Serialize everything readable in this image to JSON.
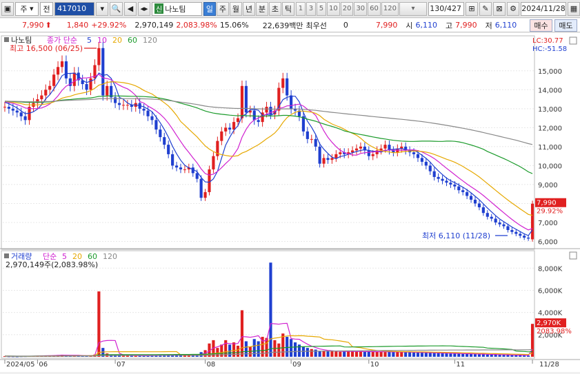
{
  "toolbar": {
    "mode": "주",
    "mode2": "전",
    "code": "417010",
    "shin": "신",
    "name": "나노팀",
    "periods": [
      "일",
      "주",
      "월",
      "년",
      "분",
      "초",
      "틱"
    ],
    "active_period": "일",
    "nums": [
      "1",
      "3",
      "5",
      "10",
      "20",
      "30",
      "60",
      "120"
    ],
    "count": "130/427",
    "date": "2024/11/28"
  },
  "quote": {
    "price": "7,990",
    "change": "1,840",
    "change_pct": "+29.92%",
    "volume": "2,970,149",
    "volume_pct": "2,083.98%",
    "turnover": "15.06%",
    "amount": "22,639백만",
    "best_label": "최우선",
    "best_value": "0",
    "best_price": "7,990",
    "open_label": "시",
    "open": "6,110",
    "high_label": "고",
    "high": "7,990",
    "low_label": "저",
    "low": "6,110",
    "buy": "매수",
    "sell": "매도"
  },
  "price_panel": {
    "stock": "나노팀",
    "legend_prefix": "종가 단순",
    "ma": [
      {
        "period": "5",
        "color": "#1f3fd0"
      },
      {
        "period": "10",
        "color": "#d020d0"
      },
      {
        "period": "20",
        "color": "#e6a800"
      },
      {
        "period": "60",
        "color": "#1a9a2a"
      },
      {
        "period": "120",
        "color": "#888888"
      }
    ],
    "lc": "LC:30.77",
    "hc": "HC:-51.58",
    "high_note": "최고 16,500 (06/25)",
    "low_note": "최저 6,110 (11/28)",
    "last_price": "7,990",
    "last_pct": "29.92%"
  },
  "volume_panel": {
    "title": "거래량",
    "legend_prefix": "단순",
    "ma": [
      "5",
      "20",
      "60",
      "120"
    ],
    "value": "2,970,149주(2,083.98%)",
    "last": "2,970K",
    "last_pct": "2083.98%"
  },
  "chart_data": {
    "type": "candlestick",
    "price_ticks": [
      6000,
      7000,
      8000,
      9000,
      10000,
      11000,
      12000,
      13000,
      14000,
      15000
    ],
    "price_tick_labels": [
      "6,000",
      "7,000",
      "8,000",
      "9,000",
      "10,000",
      "11,000",
      "12,000",
      "13,000",
      "14,000",
      "15,000"
    ],
    "price_range": [
      5800,
      16700
    ],
    "vol_ticks": [
      2000,
      4000,
      6000,
      8000
    ],
    "vol_tick_labels": [
      "2,000K",
      "4,000K",
      "6,000K",
      "8,000K"
    ],
    "vol_range": [
      0,
      9200
    ],
    "x_labels": [
      {
        "i": 0,
        "t": "2024/05"
      },
      {
        "i": 8,
        "t": "06"
      },
      {
        "i": 27,
        "t": "07"
      },
      {
        "i": 49,
        "t": "08"
      },
      {
        "i": 70,
        "t": "09"
      },
      {
        "i": 89,
        "t": "10"
      },
      {
        "i": 110,
        "t": "11"
      },
      {
        "i": 129,
        "t": "11/28"
      }
    ],
    "close": [
      13100,
      13000,
      12900,
      12800,
      12600,
      12400,
      13100,
      13300,
      13500,
      13700,
      14000,
      14200,
      14800,
      15200,
      15500,
      14600,
      14200,
      14900,
      14500,
      14300,
      14000,
      14600,
      15300,
      16200,
      13700,
      14200,
      13600,
      13300,
      13200,
      13200,
      13200,
      13100,
      13300,
      13000,
      12900,
      12600,
      12400,
      11900,
      11500,
      11100,
      10600,
      10000,
      9900,
      9800,
      9800,
      9900,
      9600,
      9300,
      8300,
      8600,
      9800,
      10500,
      11300,
      11800,
      12000,
      11900,
      12300,
      12500,
      14200,
      12800,
      12900,
      12400,
      12300,
      12800,
      13100,
      12700,
      12900,
      14100,
      14600,
      13700,
      13000,
      12900,
      12600,
      11800,
      11400,
      11400,
      11000,
      10100,
      10400,
      10300,
      10400,
      10600,
      10700,
      10600,
      10700,
      10800,
      10900,
      11000,
      10800,
      10500,
      10600,
      10800,
      10900,
      11100,
      10800,
      10700,
      10900,
      11000,
      10800,
      10700,
      10600,
      10400,
      10200,
      10000,
      9700,
      9400,
      9300,
      9200,
      9100,
      9000,
      8900,
      8700,
      8600,
      8400,
      8200,
      8000,
      7800,
      7500,
      7300,
      7200,
      7000,
      6900,
      6800,
      6600,
      6500,
      6400,
      6300,
      6200,
      6150,
      7990
    ],
    "ohlc_note": "open/high/low derived from close with small spreads",
    "volume": [
      60,
      45,
      40,
      35,
      50,
      55,
      70,
      80,
      90,
      95,
      120,
      110,
      130,
      160,
      180,
      120,
      100,
      130,
      110,
      90,
      80,
      120,
      200,
      5900,
      800,
      300,
      200,
      150,
      120,
      110,
      100,
      90,
      120,
      100,
      90,
      110,
      130,
      150,
      140,
      160,
      180,
      170,
      160,
      150,
      140,
      150,
      180,
      220,
      420,
      600,
      1200,
      1500,
      800,
      1100,
      1500,
      1100,
      1300,
      1000,
      4200,
      1400,
      900,
      1600,
      1400,
      1800,
      1700,
      8500,
      1500,
      1200,
      2100,
      1800,
      1600,
      1300,
      1100,
      900,
      800,
      700,
      650,
      500,
      550,
      500,
      520,
      480,
      450,
      500,
      470,
      520,
      460,
      480,
      450,
      460,
      470,
      440,
      460,
      430,
      440,
      450,
      430,
      420,
      410,
      400,
      390,
      380,
      370,
      360,
      350,
      340,
      330,
      320,
      310,
      300,
      290,
      280,
      270,
      260,
      250,
      240,
      230,
      220,
      210,
      200,
      190,
      180,
      170,
      160,
      150,
      140,
      130,
      120,
      110,
      2970
    ]
  }
}
